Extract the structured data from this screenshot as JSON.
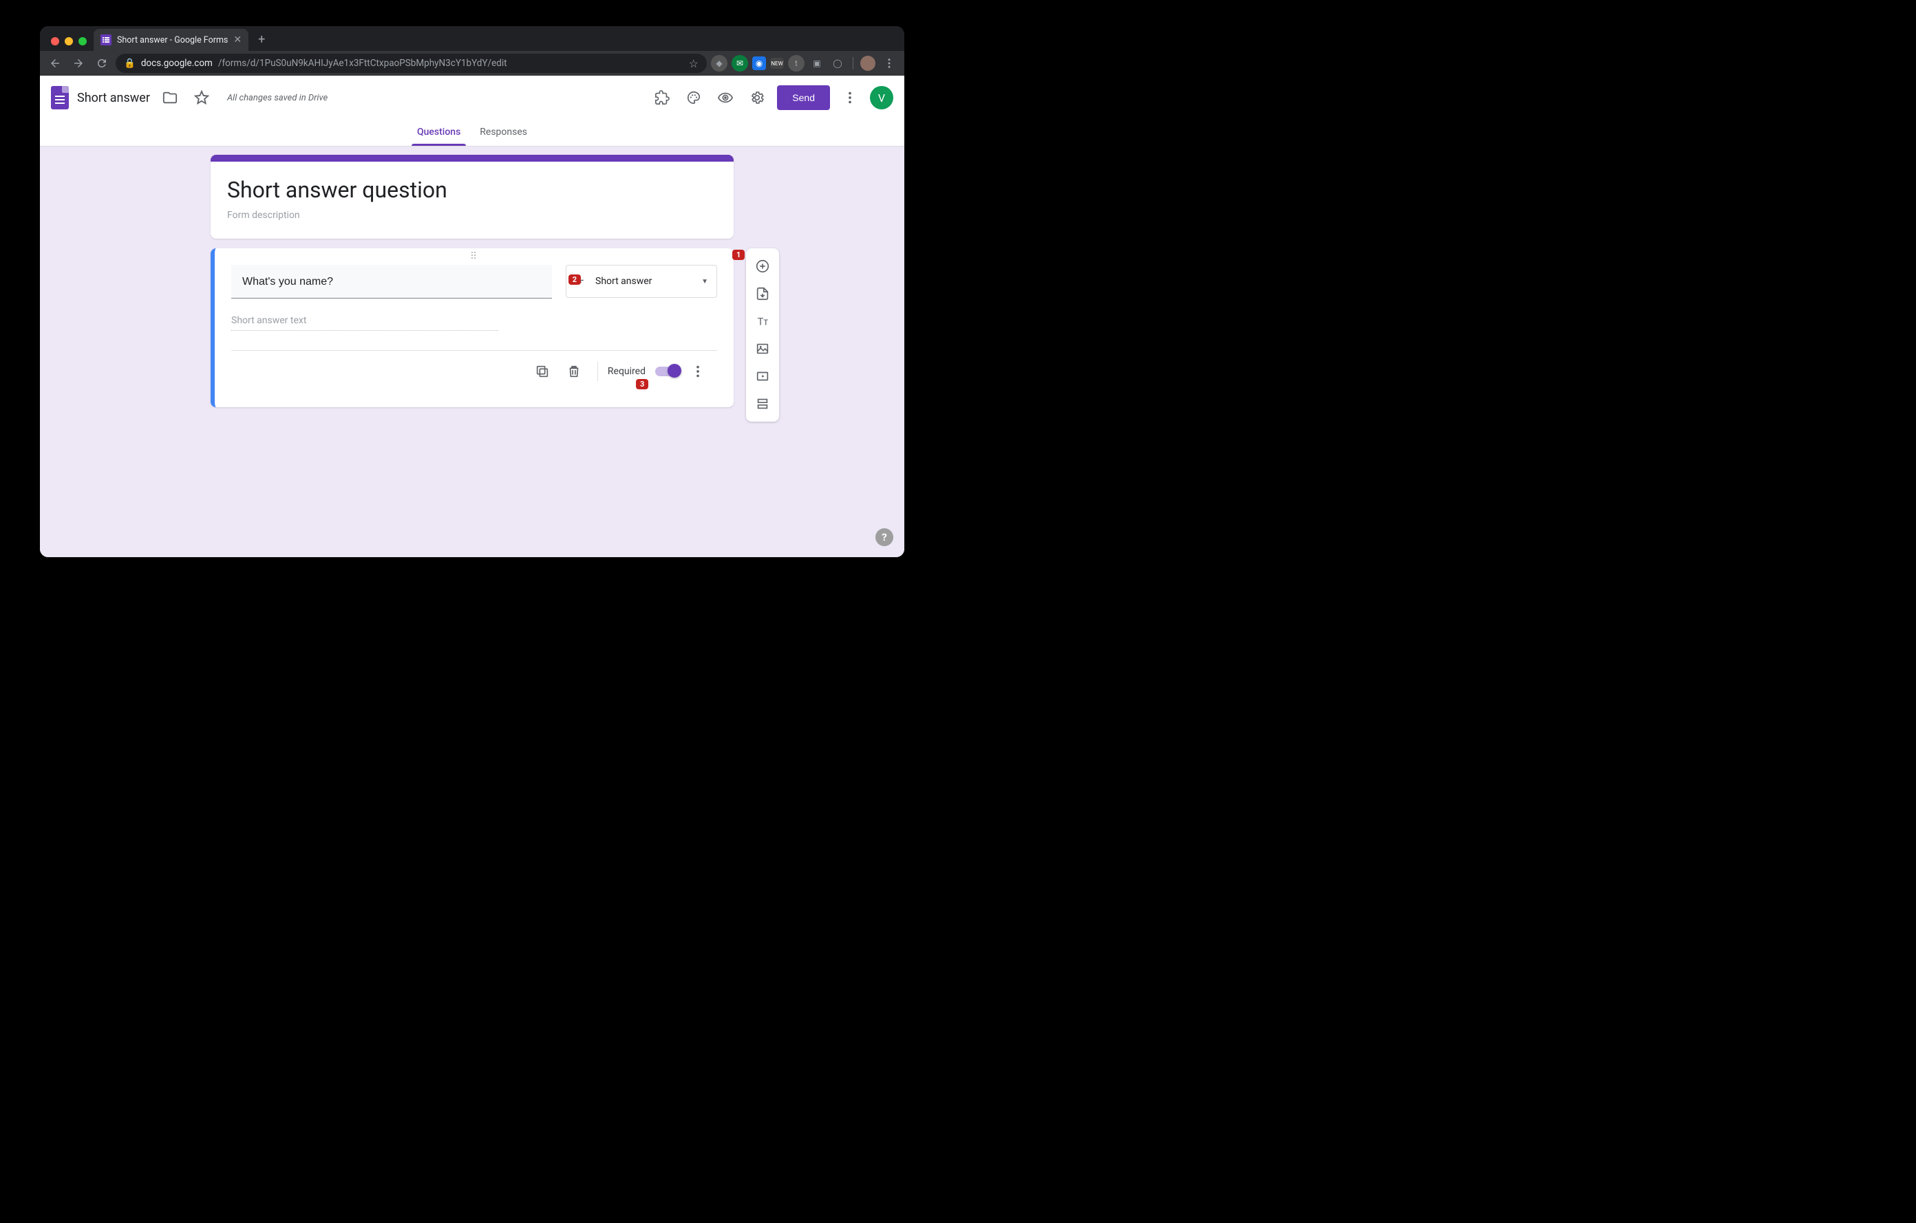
{
  "browser": {
    "tab_title": "Short answer - Google Forms",
    "url_host": "docs.google.com",
    "url_path": "/forms/d/1PuS0uN9kAHIJyAe1x3FttCtxpaoPSbMphyN3cY1bYdY/edit"
  },
  "appbar": {
    "doc_title": "Short answer",
    "saved_status": "All changes saved in Drive",
    "send_label": "Send",
    "avatar_letter": "V"
  },
  "tabs": {
    "questions": "Questions",
    "responses": "Responses"
  },
  "form_header": {
    "title": "Short answer question",
    "description_placeholder": "Form description"
  },
  "question": {
    "text": "What's you name?",
    "type_label": "Short answer",
    "answer_placeholder": "Short answer text",
    "required_label": "Required",
    "required_on": true
  },
  "annotations": {
    "b1": "1",
    "b2": "2",
    "b3": "3"
  },
  "help": "?"
}
